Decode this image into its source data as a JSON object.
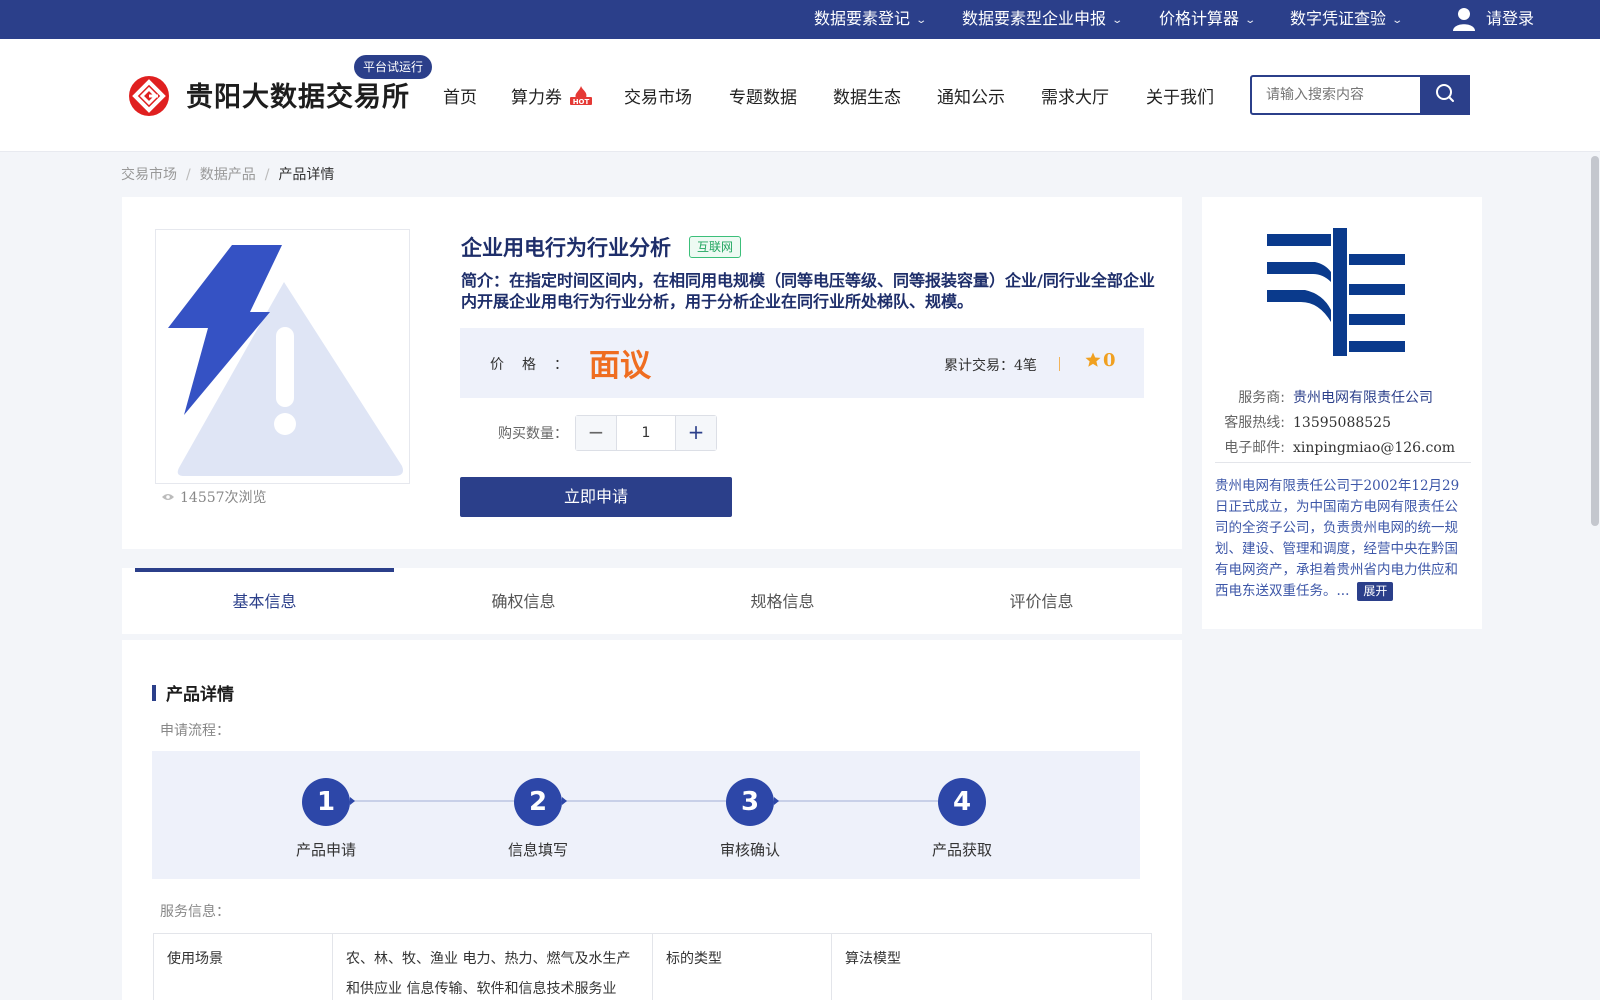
{
  "topbar": {
    "items": [
      "数据要素登记",
      "数据要素型企业申报",
      "价格计算器",
      "数字凭证查验"
    ],
    "login": "请登录"
  },
  "header": {
    "logo_text": "贵阳大数据交易所",
    "beta_badge": "平台试运行",
    "nav": [
      "首页",
      "算力券",
      "交易市场",
      "专题数据",
      "数据生态",
      "通知公示",
      "需求大厅",
      "关于我们"
    ],
    "search_placeholder": "请输入搜索内容"
  },
  "breadcrumb": [
    "交易市场",
    "数据产品",
    "产品详情"
  ],
  "product": {
    "title": "企业用电行为行业分析",
    "tag": "互联网",
    "intro": "简介：在指定时间区间内，在相同用电规模（同等电压等级、同等报装容量）企业/同行业全部企业内开展企业用电行为行业分析，用于分析企业在同行业所处梯队、规模。",
    "price_label": "价格：",
    "price": "面议",
    "trades_label": "累计交易：",
    "trades": "4笔",
    "rating": "0",
    "qty_label": "购买数量：",
    "qty": "1",
    "apply": "立即申请",
    "views": "14557次浏览"
  },
  "tabs": [
    "基本信息",
    "确权信息",
    "规格信息",
    "评价信息"
  ],
  "details": {
    "title": "产品详情",
    "flow_label": "申请流程：",
    "steps": [
      {
        "num": "1",
        "label": "产品申请"
      },
      {
        "num": "2",
        "label": "信息填写"
      },
      {
        "num": "3",
        "label": "审核确认"
      },
      {
        "num": "4",
        "label": "产品获取"
      }
    ],
    "service_label": "服务信息：",
    "table": {
      "k1": "使用场景",
      "v1": "农、林、牧、渔业 电力、热力、燃气及水生产和供应业 信息传输、软件和信息技术服务业",
      "k2": "标的类型",
      "v2": "算法模型"
    }
  },
  "provider": {
    "name_label": "服务商:",
    "name": "贵州电网有限责任公司",
    "phone_label": "客服热线:",
    "phone": "13595088525",
    "email_label": "电子邮件:",
    "email": "xinpingmiao@126.com",
    "desc": "贵州电网有限责任公司于2002年12月29日正式成立，为中国南方电网有限责任公司的全资子公司，负责贵州电网的统一规划、建设、管理和调度，经营中央在黔国有电网资产，承担着贵州省内电力供应和西电东送双重任务。...",
    "expand": "展开"
  },
  "colors": {
    "brand": "#2b3f8a",
    "price": "#ef6d20",
    "rating": "#f0a020",
    "tag": "#22a660",
    "logo_red": "#e02020"
  }
}
